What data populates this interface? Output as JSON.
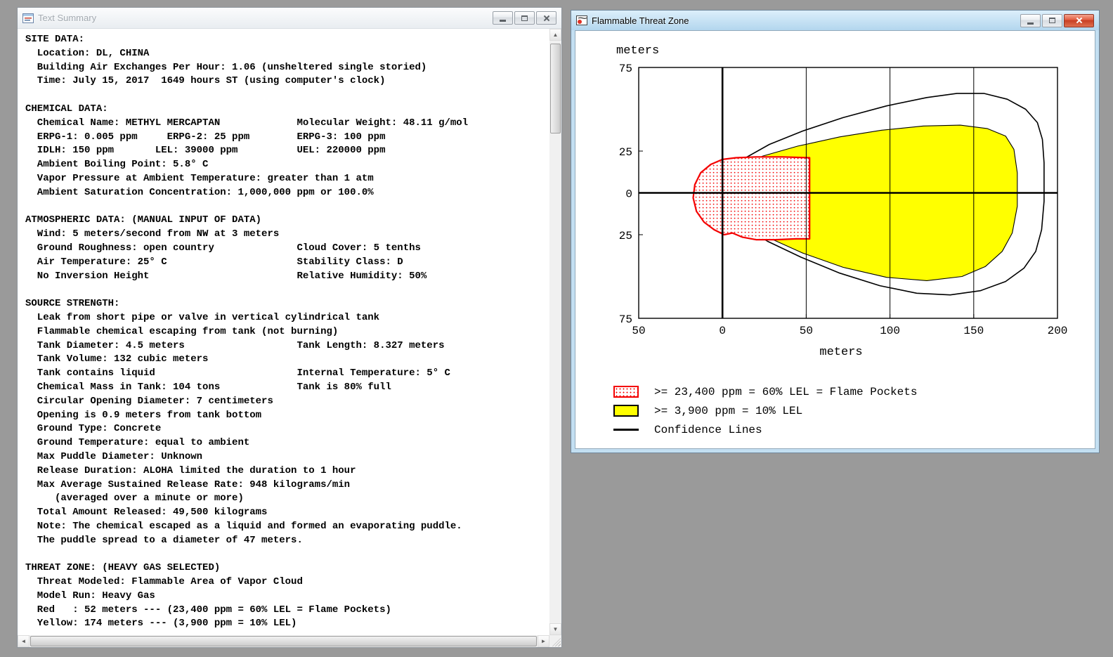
{
  "desktop": {
    "background_color": "#9a9a9a"
  },
  "text_summary_window": {
    "title": "Text Summary",
    "window_controls": [
      "minimize",
      "maximize",
      "close"
    ],
    "lines": [
      "SITE DATA:",
      "  Location: DL, CHINA",
      "  Building Air Exchanges Per Hour: 1.06 (unsheltered single storied)",
      "  Time: July 15, 2017  1649 hours ST (using computer's clock)",
      "",
      "CHEMICAL DATA:",
      "  Chemical Name: METHYL MERCAPTAN             Molecular Weight: 48.11 g/mol",
      "  ERPG-1: 0.005 ppm     ERPG-2: 25 ppm        ERPG-3: 100 ppm",
      "  IDLH: 150 ppm       LEL: 39000 ppm          UEL: 220000 ppm",
      "  Ambient Boiling Point: 5.8° C",
      "  Vapor Pressure at Ambient Temperature: greater than 1 atm",
      "  Ambient Saturation Concentration: 1,000,000 ppm or 100.0%",
      "",
      "ATMOSPHERIC DATA: (MANUAL INPUT OF DATA)",
      "  Wind: 5 meters/second from NW at 3 meters",
      "  Ground Roughness: open country              Cloud Cover: 5 tenths",
      "  Air Temperature: 25° C                      Stability Class: D",
      "  No Inversion Height                         Relative Humidity: 50%",
      "",
      "SOURCE STRENGTH:",
      "  Leak from short pipe or valve in vertical cylindrical tank",
      "  Flammable chemical escaping from tank (not burning)",
      "  Tank Diameter: 4.5 meters                   Tank Length: 8.327 meters",
      "  Tank Volume: 132 cubic meters",
      "  Tank contains liquid                        Internal Temperature: 5° C",
      "  Chemical Mass in Tank: 104 tons             Tank is 80% full",
      "  Circular Opening Diameter: 7 centimeters",
      "  Opening is 0.9 meters from tank bottom",
      "  Ground Type: Concrete",
      "  Ground Temperature: equal to ambient",
      "  Max Puddle Diameter: Unknown",
      "  Release Duration: ALOHA limited the duration to 1 hour",
      "  Max Average Sustained Release Rate: 948 kilograms/min",
      "     (averaged over a minute or more)",
      "  Total Amount Released: 49,500 kilograms",
      "  Note: The chemical escaped as a liquid and formed an evaporating puddle.",
      "  The puddle spread to a diameter of 47 meters.",
      "",
      "THREAT ZONE: (HEAVY GAS SELECTED)",
      "  Threat Modeled: Flammable Area of Vapor Cloud",
      "  Model Run: Heavy Gas",
      "  Red   : 52 meters --- (23,400 ppm = 60% LEL = Flame Pockets)",
      "  Yellow: 174 meters --- (3,900 ppm = 10% LEL)"
    ]
  },
  "threat_window": {
    "title": "Flammable Threat Zone",
    "window_controls": [
      "minimize",
      "maximize",
      "close"
    ],
    "legend": {
      "items": [
        {
          "name": "red-zone",
          "label": ">= 23,400 ppm = 60% LEL = Flame Pockets"
        },
        {
          "name": "yellow-zone",
          "label": ">= 3,900 ppm = 10% LEL"
        },
        {
          "name": "confidence-lines",
          "label": "Confidence Lines"
        }
      ]
    },
    "chart_data": {
      "type": "area",
      "title": "Flammable Threat Zone",
      "xlabel": "meters",
      "ylabel": "meters",
      "xlim": [
        -50,
        200
      ],
      "ylim": [
        -75,
        75
      ],
      "grid": true,
      "legend_position": "below",
      "xticks": [
        {
          "value": -50,
          "label": "50"
        },
        {
          "value": 0,
          "label": "0"
        },
        {
          "value": 50,
          "label": "50"
        },
        {
          "value": 100,
          "label": "100"
        },
        {
          "value": 150,
          "label": "150"
        },
        {
          "value": 200,
          "label": "200"
        }
      ],
      "yticks": [
        {
          "value": 75,
          "label": "75"
        },
        {
          "value": 25,
          "label": "25"
        },
        {
          "value": 0,
          "label": "0"
        },
        {
          "value": -25,
          "label": "25"
        },
        {
          "value": -75,
          "label": "75"
        }
      ],
      "grid_x": [
        50,
        100,
        150
      ],
      "zones": {
        "confidence": {
          "name": "Confidence Lines",
          "color": "#000000",
          "points": [
            [
              2,
              10
            ],
            [
              12,
              20
            ],
            [
              28,
              29
            ],
            [
              48,
              37
            ],
            [
              72,
              45
            ],
            [
              98,
              52
            ],
            [
              122,
              57
            ],
            [
              140,
              59.5
            ],
            [
              156,
              59.5
            ],
            [
              170,
              56
            ],
            [
              181,
              50
            ],
            [
              188,
              42
            ],
            [
              191,
              32
            ],
            [
              192,
              18
            ],
            [
              192,
              -5
            ],
            [
              190.5,
              -22
            ],
            [
              187,
              -35
            ],
            [
              180,
              -45
            ],
            [
              169,
              -53
            ],
            [
              154,
              -58.5
            ],
            [
              136,
              -61
            ],
            [
              116,
              -60
            ],
            [
              94,
              -55.5
            ],
            [
              70,
              -48
            ],
            [
              47,
              -38.5
            ],
            [
              27,
              -29
            ],
            [
              11,
              -19
            ],
            [
              2,
              -9
            ]
          ]
        },
        "yellow": {
          "name": "Flammable Area >= 10% LEL",
          "threshold_ppm": 3900,
          "downwind_extent_m": 174,
          "color": "#ffff00",
          "points": [
            [
              3,
              7
            ],
            [
              10,
              15
            ],
            [
              24,
              22
            ],
            [
              45,
              28
            ],
            [
              70,
              33.5
            ],
            [
              95,
              37.5
            ],
            [
              120,
              40
            ],
            [
              142,
              40.5
            ],
            [
              158,
              38.5
            ],
            [
              169,
              34
            ],
            [
              174,
              26
            ],
            [
              176,
              12
            ],
            [
              176,
              -8
            ],
            [
              173,
              -24
            ],
            [
              167,
              -35
            ],
            [
              157,
              -44
            ],
            [
              143,
              -50
            ],
            [
              122,
              -52.5
            ],
            [
              98,
              -50.5
            ],
            [
              72,
              -44.5
            ],
            [
              48,
              -36
            ],
            [
              28,
              -27
            ],
            [
              13,
              -18
            ],
            [
              5,
              -8
            ]
          ]
        },
        "red": {
          "name": "Flame Pockets >= 60% LEL",
          "threshold_ppm": 23400,
          "downwind_extent_m": 52,
          "color": "#f40000",
          "points": [
            [
              52,
              21
            ],
            [
              36,
              21.5
            ],
            [
              20,
              21.5
            ],
            [
              8,
              21
            ],
            [
              0,
              20
            ],
            [
              -7,
              17
            ],
            [
              -13,
              12
            ],
            [
              -16.5,
              5
            ],
            [
              -17.5,
              -3
            ],
            [
              -15.5,
              -11
            ],
            [
              -11,
              -17.5
            ],
            [
              -5,
              -22
            ],
            [
              1,
              -25
            ],
            [
              6,
              -24
            ],
            [
              12,
              -26.5
            ],
            [
              20,
              -28
            ],
            [
              32,
              -28
            ],
            [
              44,
              -27.5
            ],
            [
              52,
              -27.5
            ]
          ]
        }
      }
    }
  }
}
